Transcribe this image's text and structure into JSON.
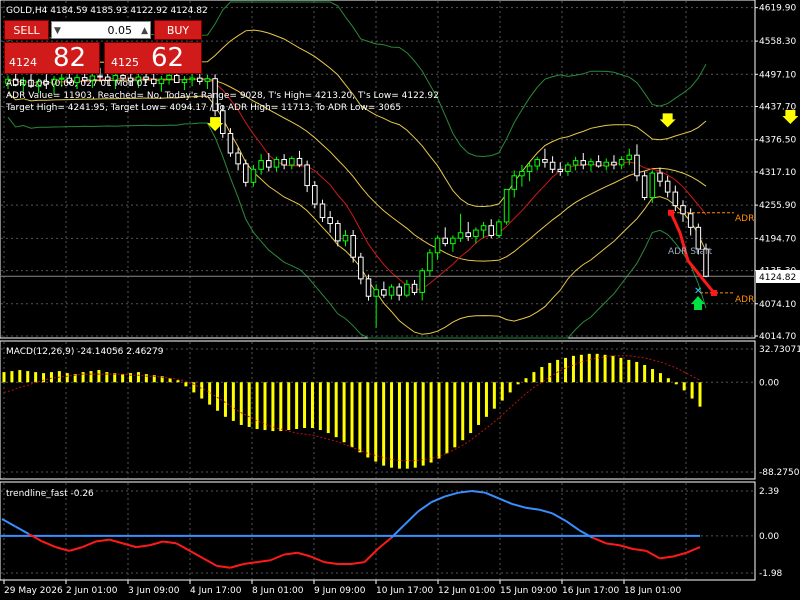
{
  "header": {
    "symbol_line": "GOLD,H4  4184.59 4185.93 4122.92 4124.82"
  },
  "trade_panel": {
    "sell_label": "SELL",
    "buy_label": "BUY",
    "lot_value": "0.05",
    "bid_small": "4124",
    "bid_big": "82",
    "ask_small": "4125",
    "ask_big": "62"
  },
  "info_lines": [
    "ADR 1.00 (0.00, 027 01 Mod 01",
    "ADR Value= 11903, Reached= No, Today's Range= 9028, T's High= 4213.20, T's Low= 4122.92",
    "Target High= 4241.95, Target Low= 4094.17 / To ADR High= 11713, To ADR Low= 3065"
  ],
  "price_labels": {
    "adr_high": "ADR",
    "adr_low": "ADR",
    "adr_start": "ADR Start"
  },
  "current_price_tag": "4124.82",
  "colors": {
    "bull": "#00ff00",
    "bear": "#ffffff",
    "macd_hist": "#ffff00",
    "macd_signal": "#c01010",
    "trend_blue": "#3a8fff",
    "trend_red": "#ff1a1a",
    "bands": "#e8c84a",
    "ma_red": "#d01818",
    "outer_green": "#2a8a3a",
    "adr": "#ff8c00",
    "trade_red": "#d11a1a"
  },
  "chart_data": [
    {
      "type": "candlestick",
      "symbol": "GOLD",
      "timeframe": "H4",
      "y_ticks": [
        4619.9,
        4558.3,
        4497.1,
        4437.7,
        4376.5,
        4317.1,
        4255.9,
        4194.7,
        4135.3,
        4074.1,
        4014.7
      ],
      "y_tick_labels": [
        "4619.90",
        "4558.30",
        "4497.10",
        "4437.70",
        "4376.50",
        "4317.10",
        "4255.90",
        "4194.70",
        "4135.30",
        "4074.10",
        "4014.70"
      ],
      "ylim": [
        4014.7,
        4623.0
      ],
      "x_tick_labels": [
        "29 May 2026",
        "2 Jun 01:00",
        "3 Jun 09:00",
        "4 Jun 17:00",
        "8 Jun 01:00",
        "9 Jun 09:00",
        "10 Jun 17:00",
        "12 Jun 01:00",
        "15 Jun 09:00",
        "16 Jun 17:00",
        "18 Jun 01:00"
      ],
      "candles": [
        [
          4480,
          4495,
          4470,
          4488
        ],
        [
          4488,
          4500,
          4475,
          4478
        ],
        [
          4478,
          4492,
          4465,
          4486
        ],
        [
          4486,
          4498,
          4472,
          4475
        ],
        [
          4475,
          4489,
          4462,
          4484
        ],
        [
          4484,
          4497,
          4470,
          4479
        ],
        [
          4479,
          4494,
          4460,
          4488
        ],
        [
          4488,
          4500,
          4474,
          4490
        ],
        [
          4490,
          4503,
          4478,
          4482
        ],
        [
          4482,
          4496,
          4470,
          4491
        ],
        [
          4491,
          4505,
          4480,
          4486
        ],
        [
          4486,
          4499,
          4472,
          4494
        ],
        [
          4494,
          4509,
          4483,
          4492
        ],
        [
          4492,
          4505,
          4478,
          4486
        ],
        [
          4486,
          4500,
          4470,
          4495
        ],
        [
          4495,
          4508,
          4484,
          4490
        ],
        [
          4490,
          4503,
          4476,
          4485
        ],
        [
          4485,
          4499,
          4472,
          4492
        ],
        [
          4492,
          4506,
          4481,
          4488
        ],
        [
          4488,
          4500,
          4474,
          4480
        ],
        [
          4480,
          4494,
          4465,
          4488
        ],
        [
          4488,
          4502,
          4478,
          4495
        ],
        [
          4495,
          4507,
          4484,
          4482
        ],
        [
          4482,
          4494,
          4468,
          4487
        ],
        [
          4487,
          4500,
          4475,
          4490
        ],
        [
          4490,
          4502,
          4478,
          4484
        ],
        [
          4484,
          4496,
          4470,
          4489
        ],
        [
          4489,
          4497,
          4420,
          4430
        ],
        [
          4430,
          4440,
          4380,
          4388
        ],
        [
          4388,
          4398,
          4345,
          4352
        ],
        [
          4352,
          4362,
          4320,
          4332
        ],
        [
          4332,
          4340,
          4290,
          4298
        ],
        [
          4298,
          4330,
          4290,
          4322
        ],
        [
          4322,
          4350,
          4312,
          4338
        ],
        [
          4338,
          4352,
          4318,
          4326
        ],
        [
          4326,
          4345,
          4318,
          4340
        ],
        [
          4340,
          4350,
          4322,
          4330
        ],
        [
          4330,
          4346,
          4322,
          4342
        ],
        [
          4342,
          4356,
          4326,
          4330
        ],
        [
          4330,
          4338,
          4280,
          4292
        ],
        [
          4292,
          4300,
          4250,
          4258
        ],
        [
          4258,
          4266,
          4225,
          4233
        ],
        [
          4233,
          4245,
          4205,
          4222
        ],
        [
          4222,
          4228,
          4180,
          4190
        ],
        [
          4190,
          4210,
          4180,
          4200
        ],
        [
          4200,
          4210,
          4150,
          4160
        ],
        [
          4160,
          4168,
          4110,
          4120
        ],
        [
          4120,
          4128,
          4080,
          4088
        ],
        [
          4088,
          4110,
          4030,
          4100
        ],
        [
          4100,
          4115,
          4085,
          4090
        ],
        [
          4090,
          4110,
          4082,
          4105
        ],
        [
          4105,
          4112,
          4080,
          4090
        ],
        [
          4090,
          4118,
          4086,
          4110
        ],
        [
          4110,
          4118,
          4090,
          4095
        ],
        [
          4095,
          4140,
          4080,
          4135
        ],
        [
          4135,
          4175,
          4125,
          4168
        ],
        [
          4168,
          4200,
          4155,
          4195
        ],
        [
          4195,
          4215,
          4180,
          4185
        ],
        [
          4185,
          4200,
          4170,
          4195
        ],
        [
          4195,
          4240,
          4188,
          4205
        ],
        [
          4205,
          4225,
          4190,
          4198
        ],
        [
          4198,
          4215,
          4185,
          4210
        ],
        [
          4210,
          4225,
          4195,
          4218
        ],
        [
          4218,
          4230,
          4195,
          4200
        ],
        [
          4200,
          4230,
          4195,
          4225
        ],
        [
          4225,
          4265,
          4220,
          4285
        ],
        [
          4285,
          4320,
          4270,
          4310
        ],
        [
          4310,
          4330,
          4290,
          4318
        ],
        [
          4318,
          4335,
          4300,
          4328
        ],
        [
          4328,
          4345,
          4320,
          4340
        ],
        [
          4340,
          4360,
          4325,
          4335
        ],
        [
          4335,
          4346,
          4315,
          4322
        ],
        [
          4322,
          4335,
          4310,
          4318
        ],
        [
          4318,
          4335,
          4310,
          4330
        ],
        [
          4330,
          4345,
          4320,
          4338
        ],
        [
          4338,
          4352,
          4322,
          4330
        ],
        [
          4330,
          4342,
          4318,
          4336
        ],
        [
          4336,
          4348,
          4325,
          4328
        ],
        [
          4328,
          4342,
          4320,
          4335
        ],
        [
          4335,
          4348,
          4322,
          4330
        ],
        [
          4330,
          4346,
          4322,
          4340
        ],
        [
          4340,
          4360,
          4330,
          4348
        ],
        [
          4348,
          4368,
          4300,
          4310
        ],
        [
          4310,
          4318,
          4265,
          4270
        ],
        [
          4270,
          4320,
          4260,
          4315
        ],
        [
          4315,
          4325,
          4290,
          4300
        ],
        [
          4300,
          4310,
          4270,
          4280
        ],
        [
          4280,
          4292,
          4245,
          4255
        ],
        [
          4255,
          4265,
          4225,
          4240
        ],
        [
          4240,
          4250,
          4200,
          4215
        ],
        [
          4215,
          4222,
          4165,
          4175
        ],
        [
          4175,
          4185,
          4122.92,
          4124.82
        ]
      ],
      "indicators": [
        "Bollinger Bands",
        "Moving Average",
        "Outer Envelope",
        "ADR"
      ]
    },
    {
      "type": "bar",
      "title": "MACD(12,26,9) -24.14056 2.46279",
      "y_tick_labels": [
        "32.73071",
        "0.00",
        "-88.27500"
      ],
      "ylim": [
        -88.275,
        32.73071
      ],
      "series": [
        {
          "values": [
            10,
            11,
            12,
            11,
            10,
            9,
            10,
            11,
            9,
            8,
            10,
            11,
            12,
            10,
            9,
            8,
            9,
            10,
            8,
            7,
            6,
            4,
            2,
            -4,
            -10,
            -16,
            -22,
            -28,
            -34,
            -38,
            -42,
            -44,
            -46,
            -47,
            -48,
            -48,
            -47,
            -46,
            -45,
            -45,
            -47,
            -50,
            -54,
            -59,
            -64,
            -69,
            -74,
            -78,
            -82,
            -84,
            -85,
            -85,
            -84,
            -82,
            -79,
            -75,
            -70,
            -64,
            -57,
            -50,
            -42,
            -34,
            -26,
            -18,
            -10,
            -2,
            4,
            10,
            15,
            19,
            22,
            24,
            26,
            27,
            28,
            28,
            27,
            26,
            24,
            22,
            20,
            17,
            13,
            9,
            4,
            -2,
            -8,
            -16,
            -24
          ]
        },
        {
          "values": [
            -10,
            -8,
            -5,
            -3,
            0,
            2,
            4,
            5,
            6,
            7,
            8,
            8,
            8,
            8,
            8,
            8,
            7,
            7,
            6,
            6,
            5,
            4,
            3,
            1,
            -2,
            -6,
            -10,
            -15,
            -20,
            -25,
            -30,
            -34,
            -38,
            -41,
            -44,
            -46,
            -48,
            -50,
            -51,
            -52,
            -54,
            -56,
            -58,
            -61,
            -64,
            -67,
            -70,
            -72,
            -74,
            -76,
            -77,
            -77,
            -77,
            -76,
            -75,
            -73,
            -70,
            -66,
            -62,
            -57,
            -51,
            -45,
            -39,
            -32,
            -25,
            -18,
            -11,
            -5,
            0,
            5,
            10,
            14,
            17,
            20,
            22,
            24,
            25,
            26,
            26,
            26,
            25,
            24,
            22,
            20,
            17,
            14,
            10,
            6,
            2
          ]
        }
      ]
    },
    {
      "type": "line",
      "title": "trendline_fast -0.26",
      "y_tick_labels": [
        "2.39",
        "0.00",
        "-1.98"
      ],
      "ylim": [
        -1.98,
        2.39
      ],
      "series": [
        {
          "values": [
            0.9,
            0.5,
            0.1,
            -0.3,
            -0.6,
            -0.8,
            -0.6,
            -0.3,
            -0.2,
            -0.4,
            -0.6,
            -0.5,
            -0.3,
            -0.4,
            -0.8,
            -1.2,
            -1.6,
            -1.7,
            -1.5,
            -1.4,
            -1.3,
            -1.0,
            -0.9,
            -1.1,
            -1.4,
            -1.5,
            -1.5,
            -1.4,
            -0.7,
            -0.1,
            0.6,
            1.3,
            1.8,
            2.1,
            2.3,
            2.39,
            2.3,
            2.0,
            1.7,
            1.5,
            1.4,
            1.2,
            0.8,
            0.3,
            -0.1,
            -0.4,
            -0.5,
            -0.7,
            -0.8,
            -1.2,
            -1.1,
            -0.9,
            -0.6
          ]
        }
      ]
    }
  ]
}
